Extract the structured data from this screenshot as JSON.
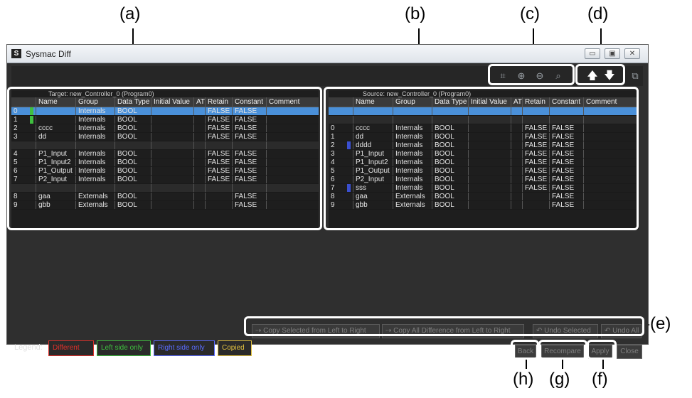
{
  "callouts": {
    "a": "(a)",
    "b": "(b)",
    "c": "(c)",
    "d": "(d)",
    "e": "(e)",
    "f": "(f)",
    "g": "(g)",
    "h": "(h)"
  },
  "window": {
    "title": "Sysmac Diff",
    "app_icon": "sysmac-icon",
    "minimize": "▭",
    "maximize": "▣",
    "close": "✕"
  },
  "toolbar": {
    "icons": [
      "fit-to-window-icon",
      "zoom-in-icon",
      "zoom-out-icon",
      "zoom-100-icon"
    ],
    "nav": {
      "up": "arrow-up-icon",
      "down": "arrow-down-icon"
    }
  },
  "left": {
    "caption": "Target: new_Controller_0 (Program0)",
    "headers": [
      "",
      "Name",
      "Group",
      "Data Type",
      "Initial Value",
      "AT",
      "Retain",
      "Constant",
      "Comment"
    ],
    "rows": [
      {
        "idx": "0",
        "name": "",
        "group": "Internals",
        "type": "BOOL",
        "init": "",
        "at": "",
        "retain": "FALSE",
        "constant": "FALSE",
        "comment": "",
        "state": "sel",
        "mark": "green"
      },
      {
        "idx": "1",
        "name": "",
        "group": "Internals",
        "type": "BOOL",
        "init": "",
        "at": "",
        "retain": "FALSE",
        "constant": "FALSE",
        "comment": "",
        "state": "",
        "mark": "green"
      },
      {
        "idx": "2",
        "name": "cccc",
        "group": "Internals",
        "type": "BOOL",
        "init": "",
        "at": "",
        "retain": "FALSE",
        "constant": "FALSE",
        "comment": "",
        "state": "",
        "mark": ""
      },
      {
        "idx": "3",
        "name": "dd",
        "group": "Internals",
        "type": "BOOL",
        "init": "",
        "at": "",
        "retain": "FALSE",
        "constant": "FALSE",
        "comment": "",
        "state": "",
        "mark": ""
      },
      {
        "idx": "",
        "name": "",
        "group": "",
        "type": "",
        "init": "",
        "at": "",
        "retain": "",
        "constant": "",
        "comment": "",
        "state": "gap",
        "mark": ""
      },
      {
        "idx": "4",
        "name": "P1_Input",
        "group": "Internals",
        "type": "BOOL",
        "init": "",
        "at": "",
        "retain": "FALSE",
        "constant": "FALSE",
        "comment": "",
        "state": "",
        "mark": ""
      },
      {
        "idx": "5",
        "name": "P1_Input2",
        "group": "Internals",
        "type": "BOOL",
        "init": "",
        "at": "",
        "retain": "FALSE",
        "constant": "FALSE",
        "comment": "",
        "state": "",
        "mark": ""
      },
      {
        "idx": "6",
        "name": "P1_Output",
        "group": "Internals",
        "type": "BOOL",
        "init": "",
        "at": "",
        "retain": "FALSE",
        "constant": "FALSE",
        "comment": "",
        "state": "",
        "mark": ""
      },
      {
        "idx": "7",
        "name": "P2_Input",
        "group": "Internals",
        "type": "BOOL",
        "init": "",
        "at": "",
        "retain": "FALSE",
        "constant": "FALSE",
        "comment": "",
        "state": "",
        "mark": ""
      },
      {
        "idx": "",
        "name": "",
        "group": "",
        "type": "",
        "init": "",
        "at": "",
        "retain": "",
        "constant": "",
        "comment": "",
        "state": "gap",
        "mark": ""
      },
      {
        "idx": "8",
        "name": "gaa",
        "group": "Externals",
        "type": "BOOL",
        "init": "",
        "at": "",
        "retain": "",
        "constant": "FALSE",
        "comment": "",
        "state": "",
        "mark": ""
      },
      {
        "idx": "9",
        "name": "gbb",
        "group": "Externals",
        "type": "BOOL",
        "init": "",
        "at": "",
        "retain": "",
        "constant": "FALSE",
        "comment": "",
        "state": "",
        "mark": ""
      }
    ]
  },
  "right": {
    "caption": "Source: new_Controller_0 (Program0)",
    "headers": [
      "",
      "Name",
      "Group",
      "Data Type",
      "Initial Value",
      "AT",
      "Retain",
      "Constant",
      "Comment"
    ],
    "rows": [
      {
        "idx": "",
        "name": "",
        "group": "",
        "type": "",
        "init": "",
        "at": "",
        "retain": "",
        "constant": "",
        "comment": "",
        "state": "sel",
        "mark": ""
      },
      {
        "idx": "",
        "name": "",
        "group": "",
        "type": "",
        "init": "",
        "at": "",
        "retain": "",
        "constant": "",
        "comment": "",
        "state": "gap",
        "mark": ""
      },
      {
        "idx": "0",
        "name": "cccc",
        "group": "Internals",
        "type": "BOOL",
        "init": "",
        "at": "",
        "retain": "FALSE",
        "constant": "FALSE",
        "comment": "",
        "state": "",
        "mark": ""
      },
      {
        "idx": "1",
        "name": "dd",
        "group": "Internals",
        "type": "BOOL",
        "init": "",
        "at": "",
        "retain": "FALSE",
        "constant": "FALSE",
        "comment": "",
        "state": "",
        "mark": ""
      },
      {
        "idx": "2",
        "name": "dddd",
        "group": "Internals",
        "type": "BOOL",
        "init": "",
        "at": "",
        "retain": "FALSE",
        "constant": "FALSE",
        "comment": "",
        "state": "",
        "mark": "blue"
      },
      {
        "idx": "3",
        "name": "P1_Input",
        "group": "Internals",
        "type": "BOOL",
        "init": "",
        "at": "",
        "retain": "FALSE",
        "constant": "FALSE",
        "comment": "",
        "state": "",
        "mark": ""
      },
      {
        "idx": "4",
        "name": "P1_Input2",
        "group": "Internals",
        "type": "BOOL",
        "init": "",
        "at": "",
        "retain": "FALSE",
        "constant": "FALSE",
        "comment": "",
        "state": "",
        "mark": ""
      },
      {
        "idx": "5",
        "name": "P1_Output",
        "group": "Internals",
        "type": "BOOL",
        "init": "",
        "at": "",
        "retain": "FALSE",
        "constant": "FALSE",
        "comment": "",
        "state": "",
        "mark": ""
      },
      {
        "idx": "6",
        "name": "P2_Input",
        "group": "Internals",
        "type": "BOOL",
        "init": "",
        "at": "",
        "retain": "FALSE",
        "constant": "FALSE",
        "comment": "",
        "state": "",
        "mark": ""
      },
      {
        "idx": "7",
        "name": "sss",
        "group": "Internals",
        "type": "BOOL",
        "init": "",
        "at": "",
        "retain": "FALSE",
        "constant": "FALSE",
        "comment": "",
        "state": "",
        "mark": "blue"
      },
      {
        "idx": "8",
        "name": "gaa",
        "group": "Externals",
        "type": "BOOL",
        "init": "",
        "at": "",
        "retain": "",
        "constant": "FALSE",
        "comment": "",
        "state": "",
        "mark": ""
      },
      {
        "idx": "9",
        "name": "gbb",
        "group": "Externals",
        "type": "BOOL",
        "init": "",
        "at": "",
        "retain": "",
        "constant": "FALSE",
        "comment": "",
        "state": "",
        "mark": ""
      }
    ]
  },
  "actions": {
    "copy_selected": "⇢ Copy Selected from Left to Right",
    "copy_all": "⇢ Copy All Difference from Left to Right",
    "undo_selected": "↶ Undo Selected",
    "undo_all": "↶ Undo All"
  },
  "legend": {
    "label": "Legend:",
    "items": [
      {
        "text": "Different",
        "color": "#e0302a"
      },
      {
        "text": "Left side only",
        "color": "#3fbf3f"
      },
      {
        "text": "Right side only",
        "color": "#5a6cff"
      },
      {
        "text": "Copied",
        "color": "#e0c040"
      }
    ]
  },
  "buttons": {
    "back": "Back",
    "recompare": "Recompare",
    "apply": "Apply",
    "close": "Close"
  },
  "colors": {
    "window_bg": "#2f2f2f",
    "selection": "#4a90d9",
    "left_only_mark": "#3fbf3f",
    "right_only_mark": "#3a4fd0"
  }
}
